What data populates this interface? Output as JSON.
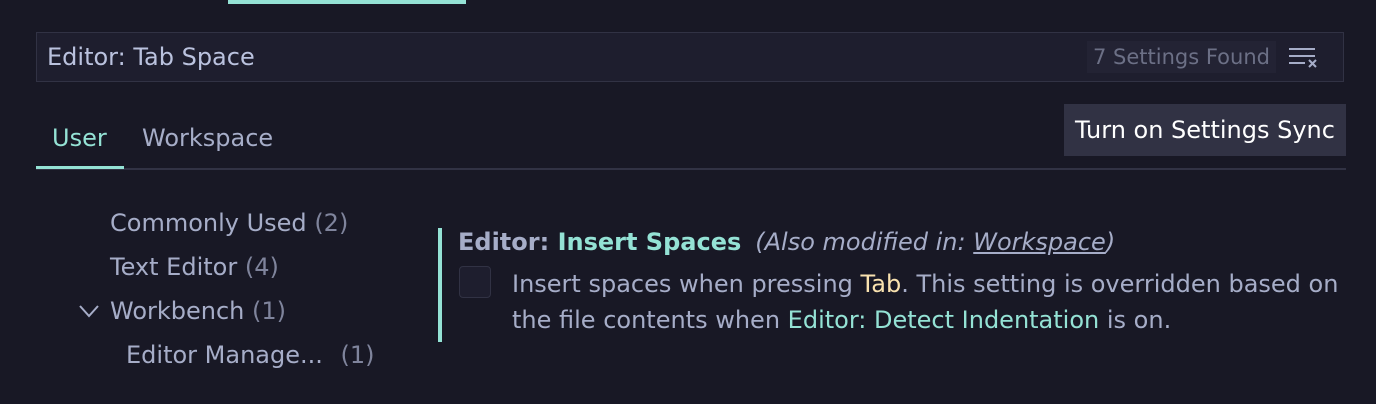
{
  "search": {
    "query": "Editor: Tab Space",
    "results_count": "7 Settings Found",
    "clear_icon": "clear-filter-icon"
  },
  "tabs": {
    "user": "User",
    "workspace": "Workspace",
    "active": "User"
  },
  "sync_button": "Turn on Settings Sync",
  "toc": {
    "commonly_used": {
      "label": "Commonly Used",
      "count": "(2)"
    },
    "text_editor": {
      "label": "Text Editor",
      "count": "(4)"
    },
    "workbench": {
      "label": "Workbench",
      "count": "(1)",
      "expanded": true
    },
    "editor_management": {
      "label": "Editor Manage...",
      "count": "(1)"
    }
  },
  "setting": {
    "category": "Editor: ",
    "name": "Insert Spaces",
    "modified_prefix": "(Also modified in: ",
    "modified_link": "Workspace",
    "modified_suffix": ")",
    "checked": false,
    "desc_part1": "Insert spaces when pressing ",
    "desc_key": "Tab",
    "desc_part2": ". This setting is overridden based on the file contents when ",
    "desc_link": "Editor: Detect Indentation",
    "desc_part3": " is on."
  },
  "colors": {
    "background": "#181825",
    "accent": "#94e2d5",
    "key_highlight": "#f9e2af",
    "sync_button_bg": "#313244"
  }
}
